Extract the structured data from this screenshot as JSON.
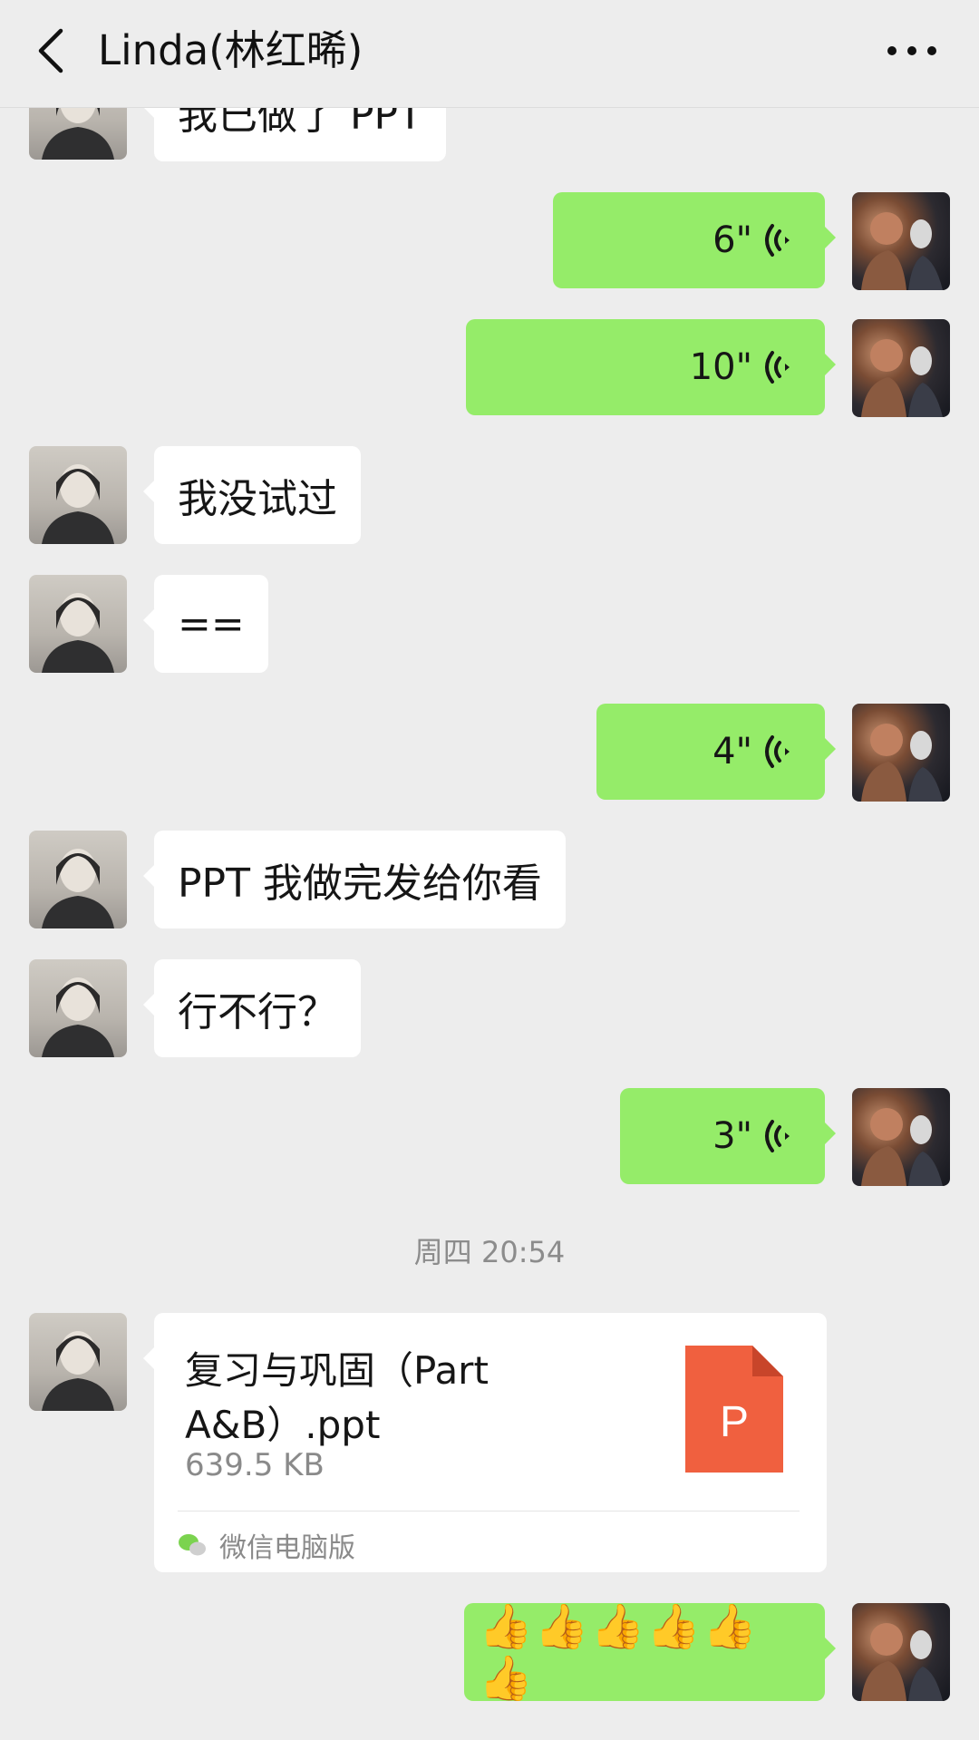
{
  "header": {
    "title": "Linda(林红晞)"
  },
  "messages": {
    "m0": {
      "text": "我已做了 PPT"
    },
    "m1": {
      "duration": "6\""
    },
    "m2": {
      "duration": "10\""
    },
    "m3": {
      "text": "我没试过"
    },
    "m4": {
      "text": "=="
    },
    "m5": {
      "duration": "4\""
    },
    "m6": {
      "text": "PPT 我做完发给你看"
    },
    "m7": {
      "text": "行不行？"
    },
    "m8": {
      "duration": "3\""
    },
    "timestamp": "周四 20:54",
    "file": {
      "name": "复习与巩固（Part A&B）.ppt",
      "size": "639.5 KB",
      "icon_letter": "P",
      "source": "微信电脑版"
    },
    "m10": {
      "text": "👍👍👍👍👍👍"
    }
  },
  "colors": {
    "background": "#ededed",
    "outgoing_bubble": "#95ec69",
    "incoming_bubble": "#ffffff",
    "ppt_icon": "#f0603f"
  }
}
